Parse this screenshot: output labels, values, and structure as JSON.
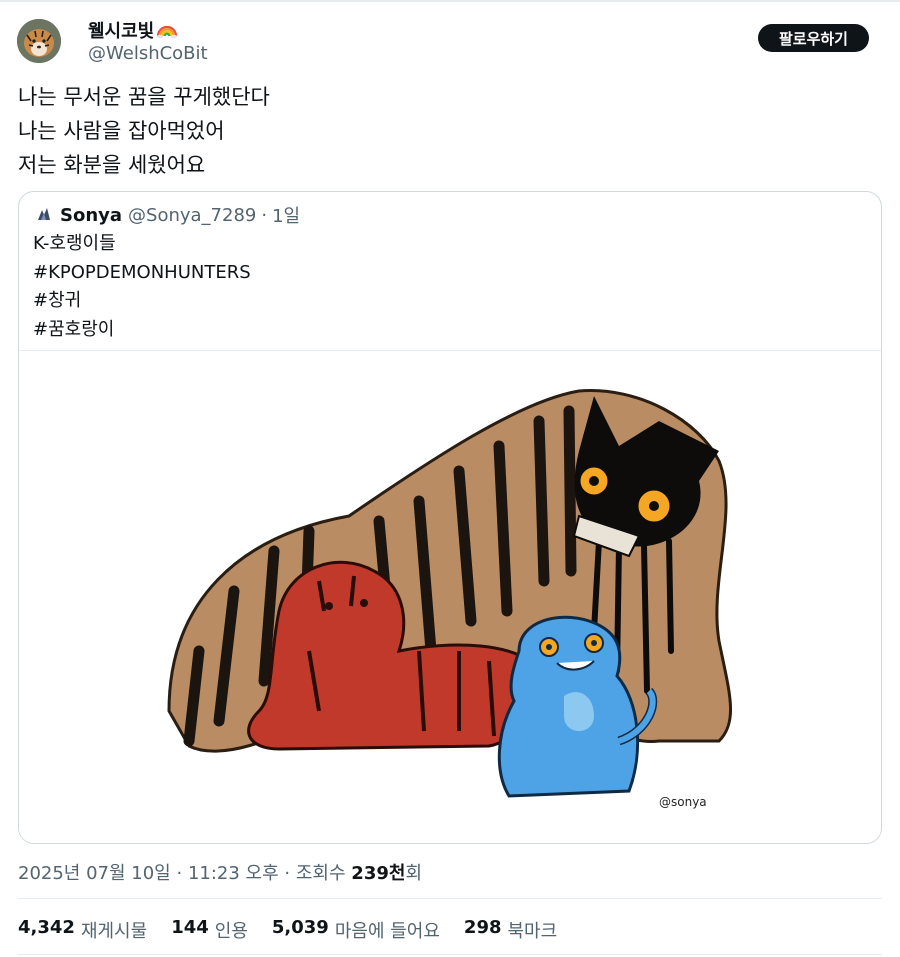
{
  "tweet": {
    "display_name": "웰시코빛",
    "handle": "@WelshCoBit",
    "follow_label": "팔로우하기",
    "lines": [
      "나는 무서운 꿈을 꾸게했단다",
      "나는 사람을 잡아먹었어",
      "저는 화분을 세웠어요"
    ],
    "icons": {
      "avatar": "tiger-avatar",
      "emoji": "rainbow-icon"
    }
  },
  "quote": {
    "name": "Sonya",
    "handle": "@Sonya_7289",
    "dot": "·",
    "time": "1일",
    "lines": [
      "K-호랭이들",
      "#KPOPDEMONHUNTERS",
      "#창귀",
      "#꿈호랑이"
    ],
    "image_signature": "@sonya"
  },
  "meta": {
    "date": "2025년 07월 10일",
    "sep1": "·",
    "time": "11:23 오후",
    "sep2": "·",
    "views_label": "조회수",
    "views_value": "239천",
    "views_suffix": "회"
  },
  "stats": {
    "retweets_count": "4,342",
    "retweets_label": "재게시물",
    "quotes_count": "144",
    "quotes_label": "인용",
    "likes_count": "5,039",
    "likes_label": "마음에 들어요",
    "bookmarks_count": "298",
    "bookmarks_label": "북마크"
  }
}
